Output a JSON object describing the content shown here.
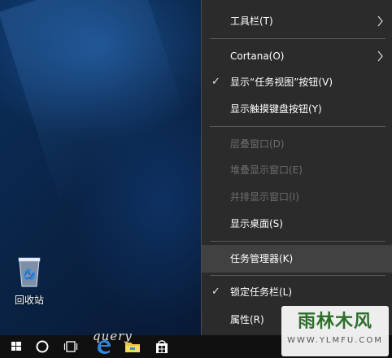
{
  "desktop": {
    "icons": [
      {
        "label": "回收站",
        "icon": "recycle-bin-icon"
      }
    ]
  },
  "context_menu": {
    "items": [
      {
        "label": "工具栏(T)",
        "checked": false,
        "disabled": false,
        "submenu": true
      },
      {
        "label": "Cortana(O)",
        "checked": false,
        "disabled": false,
        "submenu": true
      },
      {
        "label": "显示“任务视图”按钮(V)",
        "checked": true,
        "disabled": false,
        "submenu": false
      },
      {
        "label": "显示触摸键盘按钮(Y)",
        "checked": false,
        "disabled": false,
        "submenu": false
      },
      {
        "label": "层叠窗口(D)",
        "checked": false,
        "disabled": true,
        "submenu": false
      },
      {
        "label": "堆叠显示窗口(E)",
        "checked": false,
        "disabled": true,
        "submenu": false
      },
      {
        "label": "并排显示窗口(I)",
        "checked": false,
        "disabled": true,
        "submenu": false
      },
      {
        "label": "显示桌面(S)",
        "checked": false,
        "disabled": false,
        "submenu": false
      },
      {
        "label": "任务管理器(K)",
        "checked": false,
        "disabled": false,
        "submenu": false,
        "highlighted": true
      },
      {
        "label": "锁定任务栏(L)",
        "checked": true,
        "disabled": false,
        "submenu": false
      },
      {
        "label": "属性(R)",
        "checked": false,
        "disabled": false,
        "submenu": false
      }
    ],
    "check_glyph": "✓"
  },
  "taskbar": {
    "buttons": [
      "start-icon",
      "cortana-circle-icon",
      "task-view-icon",
      "edge-icon",
      "file-explorer-icon",
      "store-icon"
    ],
    "handwriting": "query"
  },
  "watermark": {
    "title": "雨林木风",
    "url": "WWW.YLMFU.COM"
  },
  "colors": {
    "menu_bg": "#2b2b2b",
    "menu_hover": "#414141",
    "taskbar_bg": "#101010",
    "watermark_green": "#2d6e2b"
  }
}
